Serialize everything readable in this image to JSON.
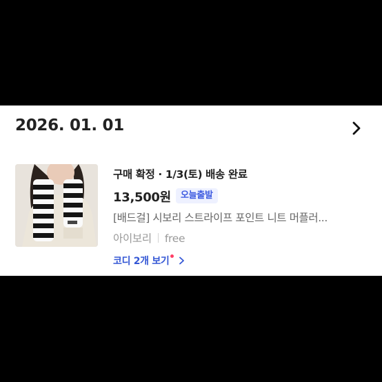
{
  "order": {
    "date": "2026. 01. 01",
    "status": "구매 확정 · 1/3(토) 배송 완료",
    "price": "13,500원",
    "badge": "오늘출발",
    "product_name": "[배드걸] 시보리 스트라이프 포인트 니트 머플러...",
    "option_color": "아이보리",
    "option_size": "free",
    "coordi_link": "코디 2개 보기"
  },
  "icons": {
    "detail": "chevron-right-icon",
    "coordi": "chevron-right-icon"
  },
  "colors": {
    "badge_bg": "#eef1ff",
    "badge_text": "#3e5be0",
    "link": "#3457d5",
    "dot": "#ff3e66"
  }
}
